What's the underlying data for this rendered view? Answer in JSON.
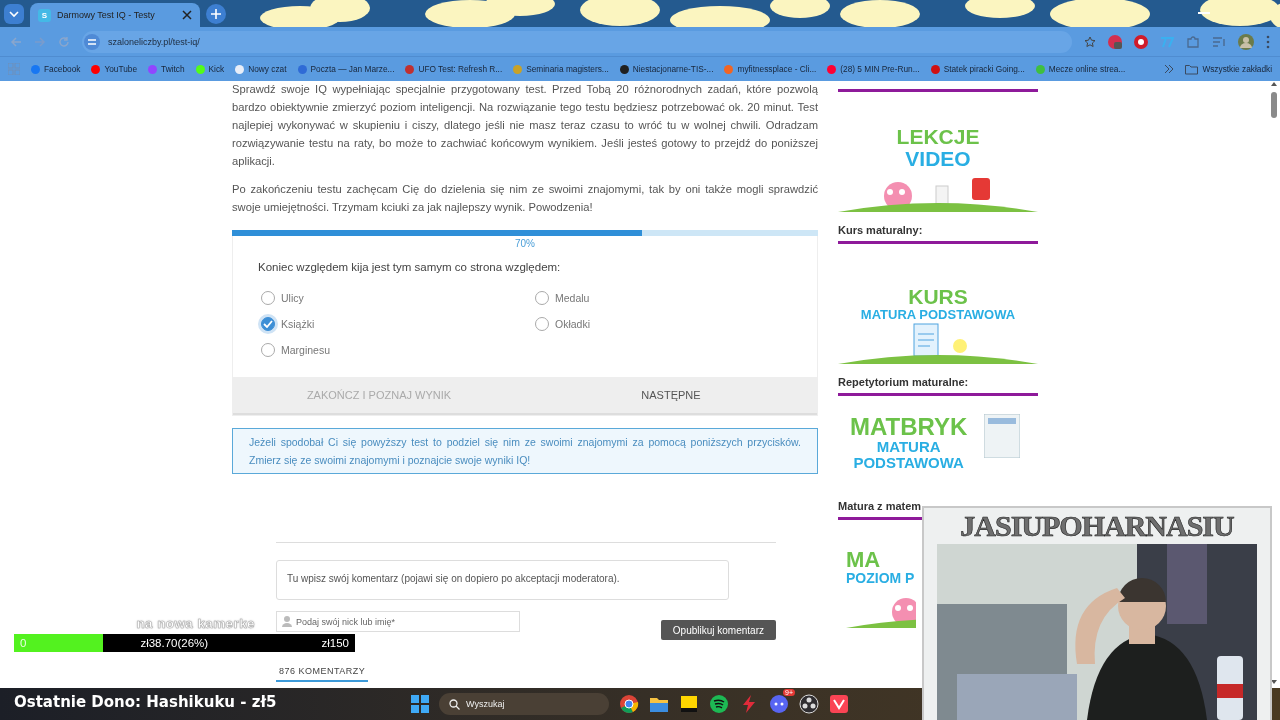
{
  "browser": {
    "tab": {
      "favicon_letter": "S",
      "title": "Darmowy Test IQ - Testy",
      "selected": true
    },
    "url": "szaloneliczby.pl/test-iq/",
    "bookmarks": [
      {
        "label": "Facebook",
        "color": "#1877f2"
      },
      {
        "label": "YouTube",
        "color": "#ff0000"
      },
      {
        "label": "Twitch",
        "color": "#9146ff"
      },
      {
        "label": "Kick",
        "color": "#53fc18"
      },
      {
        "label": "Nowy czat",
        "color": "#e8eef8"
      },
      {
        "label": "Poczta — Jan Marze...",
        "color": "#2f6bd6"
      },
      {
        "label": "UFO Test: Refresh R...",
        "color": "#c03030"
      },
      {
        "label": "Seminaria magisters...",
        "color": "#c9a227"
      },
      {
        "label": "Niestacjonarne-TIS-...",
        "color": "#202020"
      },
      {
        "label": "myfitnessplace - Cli...",
        "color": "#f26522"
      },
      {
        "label": "(28) 5 MIN Pre-Run...",
        "color": "#ff0033"
      },
      {
        "label": "Statek piracki Going...",
        "color": "#d01012"
      },
      {
        "label": "Mecze online strea...",
        "color": "#3fbf3f"
      }
    ],
    "all_bookmarks": "Wszystkie zakładki"
  },
  "article": {
    "paragraphs": [
      "Sprawdź swoje IQ wypełniając specjalnie przygotowany test. Przed Tobą 20 różnorodnych zadań, które pozwolą bardzo obiektywnie zmierzyć poziom inteligencji. Na rozwiązanie tego testu będziesz potrzebować ok. 20 minut. Test najlepiej wykonywać w skupieniu i ciszy, dlatego jeśli nie masz teraz czasu to wróć tu w wolnej chwili. Odradzam rozwiązywanie testu na raty, bo może to zachwiać końcowym wynikiem. Jeśli jesteś gotowy to przejdź do poniższej aplikacji.",
      "Po zakończeniu testu zachęcam Cię do dzielenia się nim ze swoimi znajomymi, tak by oni także mogli sprawdzić swoje umiejętności. Trzymam kciuki za jak najlepszy wynik. Powodzenia!"
    ]
  },
  "quiz": {
    "progress": {
      "level": 0.7,
      "reading": "70%"
    },
    "question": "Koniec względem kija jest tym samym co strona względem:",
    "options": [
      {
        "label": "Ulicy",
        "selected": false
      },
      {
        "label": "Medalu",
        "selected": false
      },
      {
        "label": "Książki",
        "selected": true
      },
      {
        "label": "Okładki",
        "selected": false
      },
      {
        "label": "Marginesu",
        "selected": false
      }
    ],
    "buttons": [
      {
        "label": "ZAKOŃCZ I POZNAJ WYNIK",
        "disabled": true
      },
      {
        "label": "NASTĘPNE",
        "disabled": false
      }
    ]
  },
  "share_note": "Jeżeli spodobał Ci się powyższy test to podziel się nim ze swoimi znajomymi za pomocą poniższych przycisków. Zmierz się ze swoimi znajomymi i poznajcie swoje wyniki IQ!",
  "comments": {
    "comment_placeholder": "Tu wpisz swój komentarz (pojawi się on dopiero po akceptacji moderatora).",
    "name_placeholder": "Podaj swój nick lub imię*",
    "submit": "Opublikuj komentarz",
    "count_tab": "876 KOMENTARZY"
  },
  "sidebar": {
    "sections": [
      {
        "banner": {
          "kind": "brain",
          "lines": [
            {
              "text": "LEKCJE",
              "kind": "title"
            },
            {
              "text": "VIDEO",
              "kind": "subtitle"
            }
          ]
        }
      },
      {
        "heading": "Kurs maturalny:",
        "banner": {
          "kind": "document",
          "lines": [
            {
              "text": "KURS",
              "kind": "title"
            },
            {
              "text": "MATURA PODSTAWOWA",
              "kind": "subtitle"
            }
          ]
        }
      },
      {
        "heading": "Repetytorium maturalne:",
        "banner": {
          "kind": "book",
          "lines": [
            {
              "text": "MATBRYK",
              "kind": "title"
            },
            {
              "text": "MATURA",
              "kind": "subtitle"
            },
            {
              "text": "PODSTAWOWA",
              "kind": "subtitle"
            }
          ]
        }
      },
      {
        "heading": "Matura z matem",
        "banner": {
          "kind": "brain",
          "lines": [
            {
              "text": "MA",
              "kind": "title"
            },
            {
              "text": "POZIOM P",
              "kind": "subtitle"
            }
          ]
        }
      }
    ]
  },
  "stream_overlay": {
    "goal": {
      "caption": "na nowa kamerke",
      "start": "0",
      "current": "zł38.70(26%)",
      "target": "zł150",
      "level": 0.26
    },
    "last_donation": "Ostatnie Dono: Hashikuku - zł5",
    "camera_title": "JASIUPOHARNASIU"
  },
  "taskbar": {
    "search_placeholder": "Wyszukaj",
    "apps": [
      {
        "kind": "chrome"
      },
      {
        "kind": "folder"
      },
      {
        "kind": "notes"
      },
      {
        "kind": "spotify"
      },
      {
        "kind": "bolt"
      },
      {
        "kind": "discord",
        "badge": "9+"
      },
      {
        "kind": "obs"
      },
      {
        "kind": "valorant"
      }
    ]
  }
}
